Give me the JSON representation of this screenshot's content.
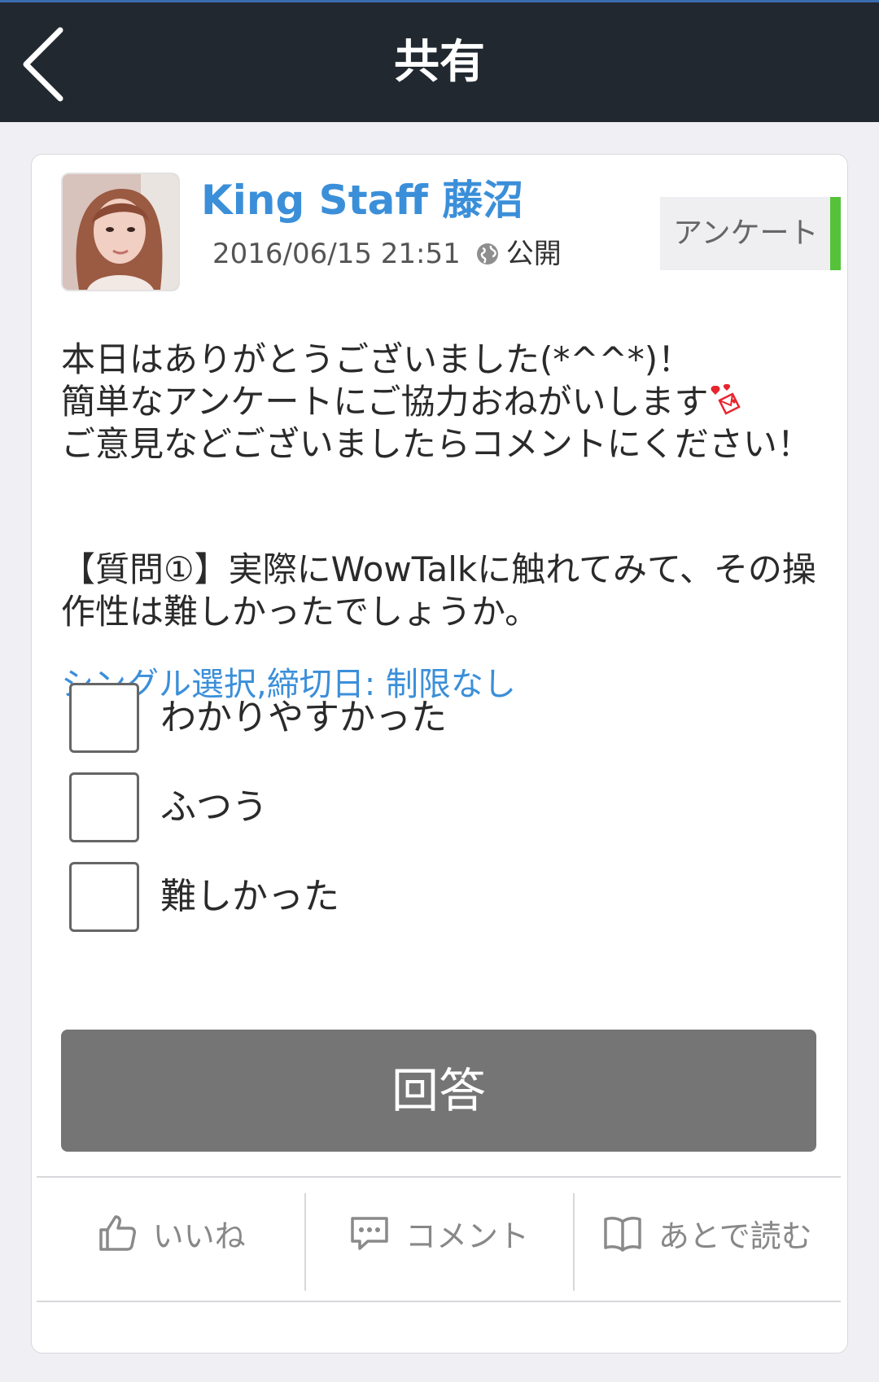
{
  "header": {
    "title": "共有",
    "back_icon": "chevron-left-icon"
  },
  "post": {
    "author": "King Staff 藤沼",
    "timestamp": "2016/06/15 21:51",
    "visibility": "公開",
    "visibility_icon": "globe-icon",
    "tag": "アンケート",
    "tag_accent_color": "#55c23a",
    "body_line1": "本日はありがとうございました(*^^*)！",
    "body_line2": "簡単なアンケートにご協力おねがいします",
    "body_line3": "ご意見などございましたらコメントにください！",
    "body_emoji_icon": "heart-letter-icon",
    "question": "【質問①】実際にWowTalkに触れてみて、その操作性は難しかったでしょうか。"
  },
  "survey": {
    "meta": "シングル選択,締切日: 制限なし",
    "options": [
      {
        "label": "わかりやすかった",
        "checked": false
      },
      {
        "label": "ふつう",
        "checked": false
      },
      {
        "label": "難しかった",
        "checked": false
      }
    ],
    "answer_label": "回答"
  },
  "actions": {
    "like_label": "いいね",
    "like_icon": "thumbs-up-icon",
    "comment_label": "コメント",
    "comment_icon": "comment-icon",
    "read_later_label": "あとで読む",
    "read_later_icon": "book-icon"
  },
  "colors": {
    "header_bg": "#212830",
    "accent_blue": "#3b8fd9",
    "answer_button": "#757575"
  }
}
